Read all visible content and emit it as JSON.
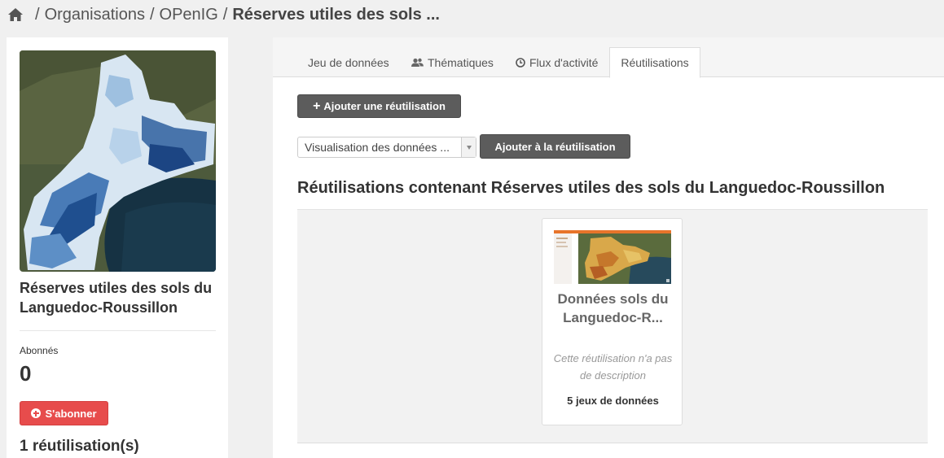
{
  "breadcrumb": {
    "items": [
      "Organisations",
      "OPenIG"
    ],
    "current": "Réserves utiles des sols ..."
  },
  "sidebar": {
    "dataset_title": "Réserves utiles des sols du Languedoc-Roussillon",
    "followers_label": "Abonnés",
    "followers_count": "0",
    "subscribe_label": "S'abonner",
    "reuse_count": "1 réutilisation(s)"
  },
  "tabs": [
    {
      "label": "Jeu de données",
      "icon": ""
    },
    {
      "label": "Thématiques",
      "icon": "users-icon"
    },
    {
      "label": "Flux d'activité",
      "icon": "clock-icon"
    },
    {
      "label": "Réutilisations",
      "icon": "",
      "active": true
    }
  ],
  "actions": {
    "add_reuse_label": "Ajouter une réutilisation",
    "select_value": "Visualisation des données ...",
    "add_to_reuse_label": "Ajouter à la réutilisation"
  },
  "section_title": "Réutilisations contenant Réserves utiles des sols du Languedoc-Roussillon",
  "reuse_card": {
    "title": "Données sols du Languedoc-R...",
    "description": "Cette réutilisation n'a pas de description",
    "datasets": "5 jeux de données"
  },
  "colors": {
    "subscribe": "#e74c4c",
    "dark_button": "#5c5c5c",
    "map_blue": "#1f4f8f"
  }
}
